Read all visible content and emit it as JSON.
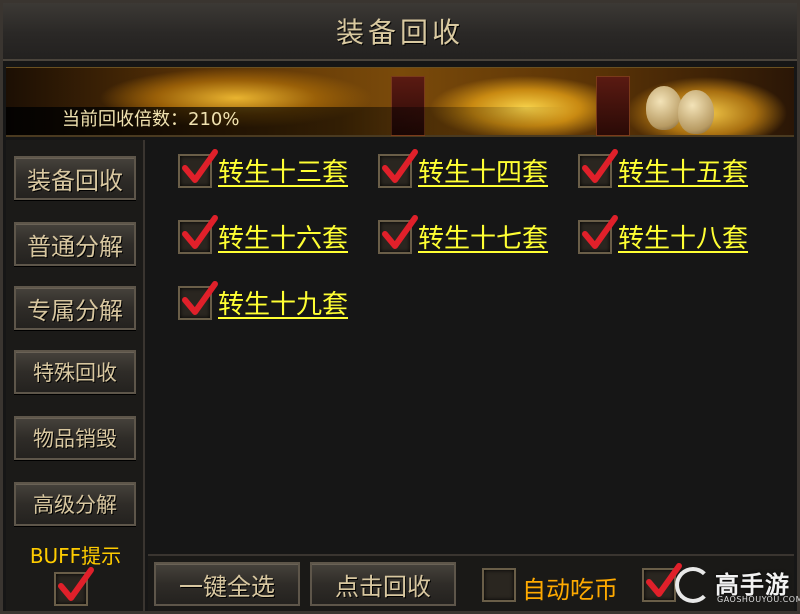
{
  "window": {
    "title": "装备回收"
  },
  "banner": {
    "rate_text": "当前回收倍数：210%"
  },
  "sidebar": {
    "items": [
      {
        "label": "装备回收",
        "active": true
      },
      {
        "label": "普通分解"
      },
      {
        "label": "专属分解"
      },
      {
        "label": "特殊回收"
      },
      {
        "label": "物品销毁"
      },
      {
        "label": "高级分解"
      }
    ],
    "buff": {
      "label": "BUFF提示",
      "checked": true
    }
  },
  "options": [
    {
      "label": "转生十三套",
      "checked": true
    },
    {
      "label": "转生十四套",
      "checked": true
    },
    {
      "label": "转生十五套",
      "checked": true
    },
    {
      "label": "转生十六套",
      "checked": true
    },
    {
      "label": "转生十七套",
      "checked": true
    },
    {
      "label": "转生十八套",
      "checked": true
    },
    {
      "label": "转生十九套",
      "checked": true
    }
  ],
  "bottom": {
    "select_all_label": "一键全选",
    "recycle_label": "点击回收",
    "auto_coin": {
      "label": "自动吃币",
      "checked": false
    },
    "auto_recycle": {
      "checked": true
    }
  },
  "watermark": {
    "name": "高手游",
    "url": "GAOSHOUYOU.COM"
  },
  "colors": {
    "option_text": "#ffff33",
    "buff_text": "#ffcc00",
    "auto_text": "#ffaa00",
    "check_red": "#e0202a"
  }
}
